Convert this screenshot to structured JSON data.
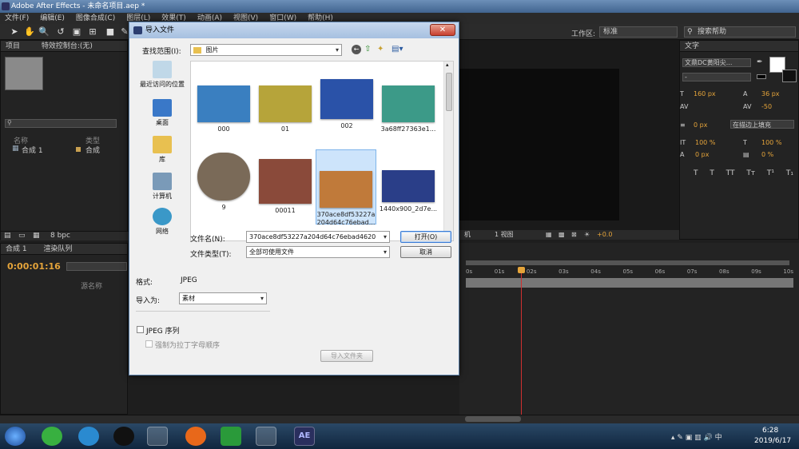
{
  "app": {
    "title": "Adobe After Effects - 未命名项目.aep *"
  },
  "menu": [
    "文件(F)",
    "编辑(E)",
    "图像合成(C)",
    "图层(L)",
    "效果(T)",
    "动画(A)",
    "视图(V)",
    "窗口(W)",
    "帮助(H)"
  ],
  "toolbar": {
    "workspace_label": "工作区:",
    "workspace_value": "标准",
    "search_help": "搜索帮助"
  },
  "project_panel": {
    "tab_project": "项目",
    "tab_effects": "特效控制台:(无)",
    "col_name": "名称",
    "col_type": "类型",
    "item_name": "合成 1",
    "item_type": "合成",
    "bpc": "8 bpc"
  },
  "timeline_panel": {
    "tab_comp": "合成 1",
    "tab_render": "渲染队列",
    "timecode": "0:00:01:16",
    "col_source": "源名称",
    "ruler": [
      "0s",
      "01s",
      "02s",
      "03s",
      "04s",
      "05s",
      "06s",
      "07s",
      "08s",
      "09s",
      "10s"
    ],
    "views": "1 视图",
    "exposure": "+0.0",
    "view_dd": "机"
  },
  "character_panel": {
    "tab": "文字",
    "font": "文鼎DC黄阳尖...",
    "font_style": "-",
    "size": "160 px",
    "leading": "36 px",
    "tracking": "-50",
    "stroke_width": "0 px",
    "stroke_mode": "在描边上填充",
    "vscale": "100 %",
    "hscale": "100 %",
    "baseline": "0 px",
    "tsume": "0 %",
    "styles": [
      "T",
      "T",
      "TT",
      "Tт",
      "T¹",
      "T₁"
    ]
  },
  "dialog": {
    "title": "导入文件",
    "close": "✕",
    "look_in_label": "查找范围(I):",
    "look_in_value": "图片",
    "places": [
      "最近访问的位置",
      "桌面",
      "库",
      "计算机",
      "网络"
    ],
    "files": [
      {
        "name": "000",
        "color": "#3a7fc0"
      },
      {
        "name": "01",
        "color": "#b6a43a"
      },
      {
        "name": "002",
        "color": "#2a52a8"
      },
      {
        "name": "3a68ff27363e1...",
        "color": "#3c9a88"
      },
      {
        "name": "9",
        "color": "#7a6a58"
      },
      {
        "name": "00011",
        "color": "#8a4a3a"
      },
      {
        "name": "370ace8df53227a204d64c76ebad...",
        "color": "#c07a3a"
      },
      {
        "name": "1440x900_2d7e...",
        "color": "#2a3e88"
      }
    ],
    "filename_label": "文件名(N):",
    "filename_value": "370ace8df53227a204d64c76ebad4620",
    "filetype_label": "文件类型(T):",
    "filetype_value": "全部可使用文件",
    "open_button": "打开(O)",
    "cancel_button": "取消",
    "format_label": "格式:",
    "format_value": "JPEG",
    "import_as_label": "导入为:",
    "import_as_value": "素材",
    "jpeg_sequence": "JPEG 序列",
    "force_alpha": "强制为拉丁字母顺序",
    "import_folder": "导入文件夹"
  },
  "taskbar": {
    "time": "6:28",
    "date": "2019/6/17",
    "ae_label": "AE"
  }
}
